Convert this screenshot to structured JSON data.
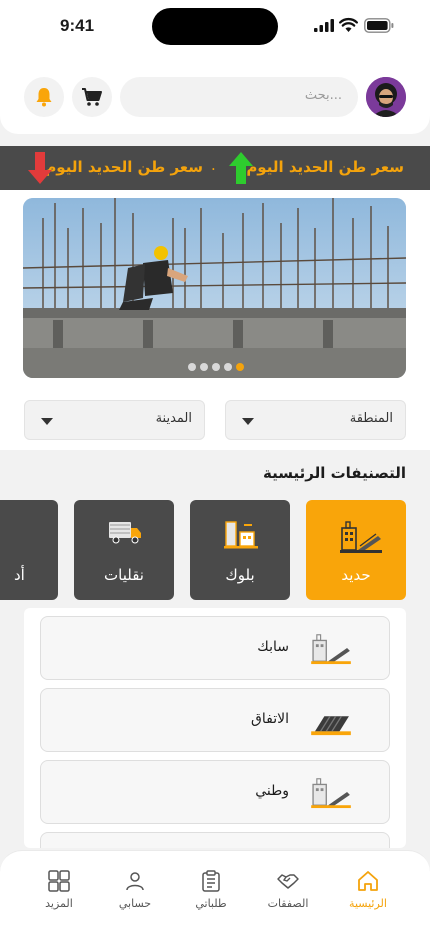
{
  "status_bar": {
    "time": "9:41"
  },
  "header": {
    "search_placeholder": "بحث...",
    "icons": [
      "avatar",
      "cart-icon",
      "bell-icon"
    ]
  },
  "ticker": {
    "item_1": "سعر طن الحديد اليوم",
    "separator": ".",
    "item_2": "سعر طن الحديد اليوم",
    "up_color": "#2ecc2e",
    "down_color": "#e23b3b"
  },
  "banner": {
    "slide_count": 5,
    "active_slide": 5
  },
  "filters": {
    "region_label": "المنطقة",
    "city_label": "المدينة"
  },
  "categories": {
    "title": "التصنيفات الرئيسية",
    "items": [
      {
        "label": "حديد",
        "active": true
      },
      {
        "label": "بلوك",
        "active": false
      },
      {
        "label": "نقليات",
        "active": false
      },
      {
        "label": "أد",
        "active": false
      }
    ]
  },
  "subcategories": [
    {
      "label": "سابك"
    },
    {
      "label": "الاتفاق"
    },
    {
      "label": "وطني"
    }
  ],
  "nav": {
    "items": [
      {
        "label": "الرئيسية",
        "icon": "home-icon",
        "active": true
      },
      {
        "label": "الصفقات",
        "icon": "handshake-icon",
        "active": false
      },
      {
        "label": "طلباتي",
        "icon": "clipboard-icon",
        "active": false
      },
      {
        "label": "حسابي",
        "icon": "user-icon",
        "active": false
      },
      {
        "label": "المزيد",
        "icon": "grid-icon",
        "active": false
      }
    ]
  },
  "colors": {
    "accent": "#f9a50a",
    "dark": "#4a4a4a"
  }
}
